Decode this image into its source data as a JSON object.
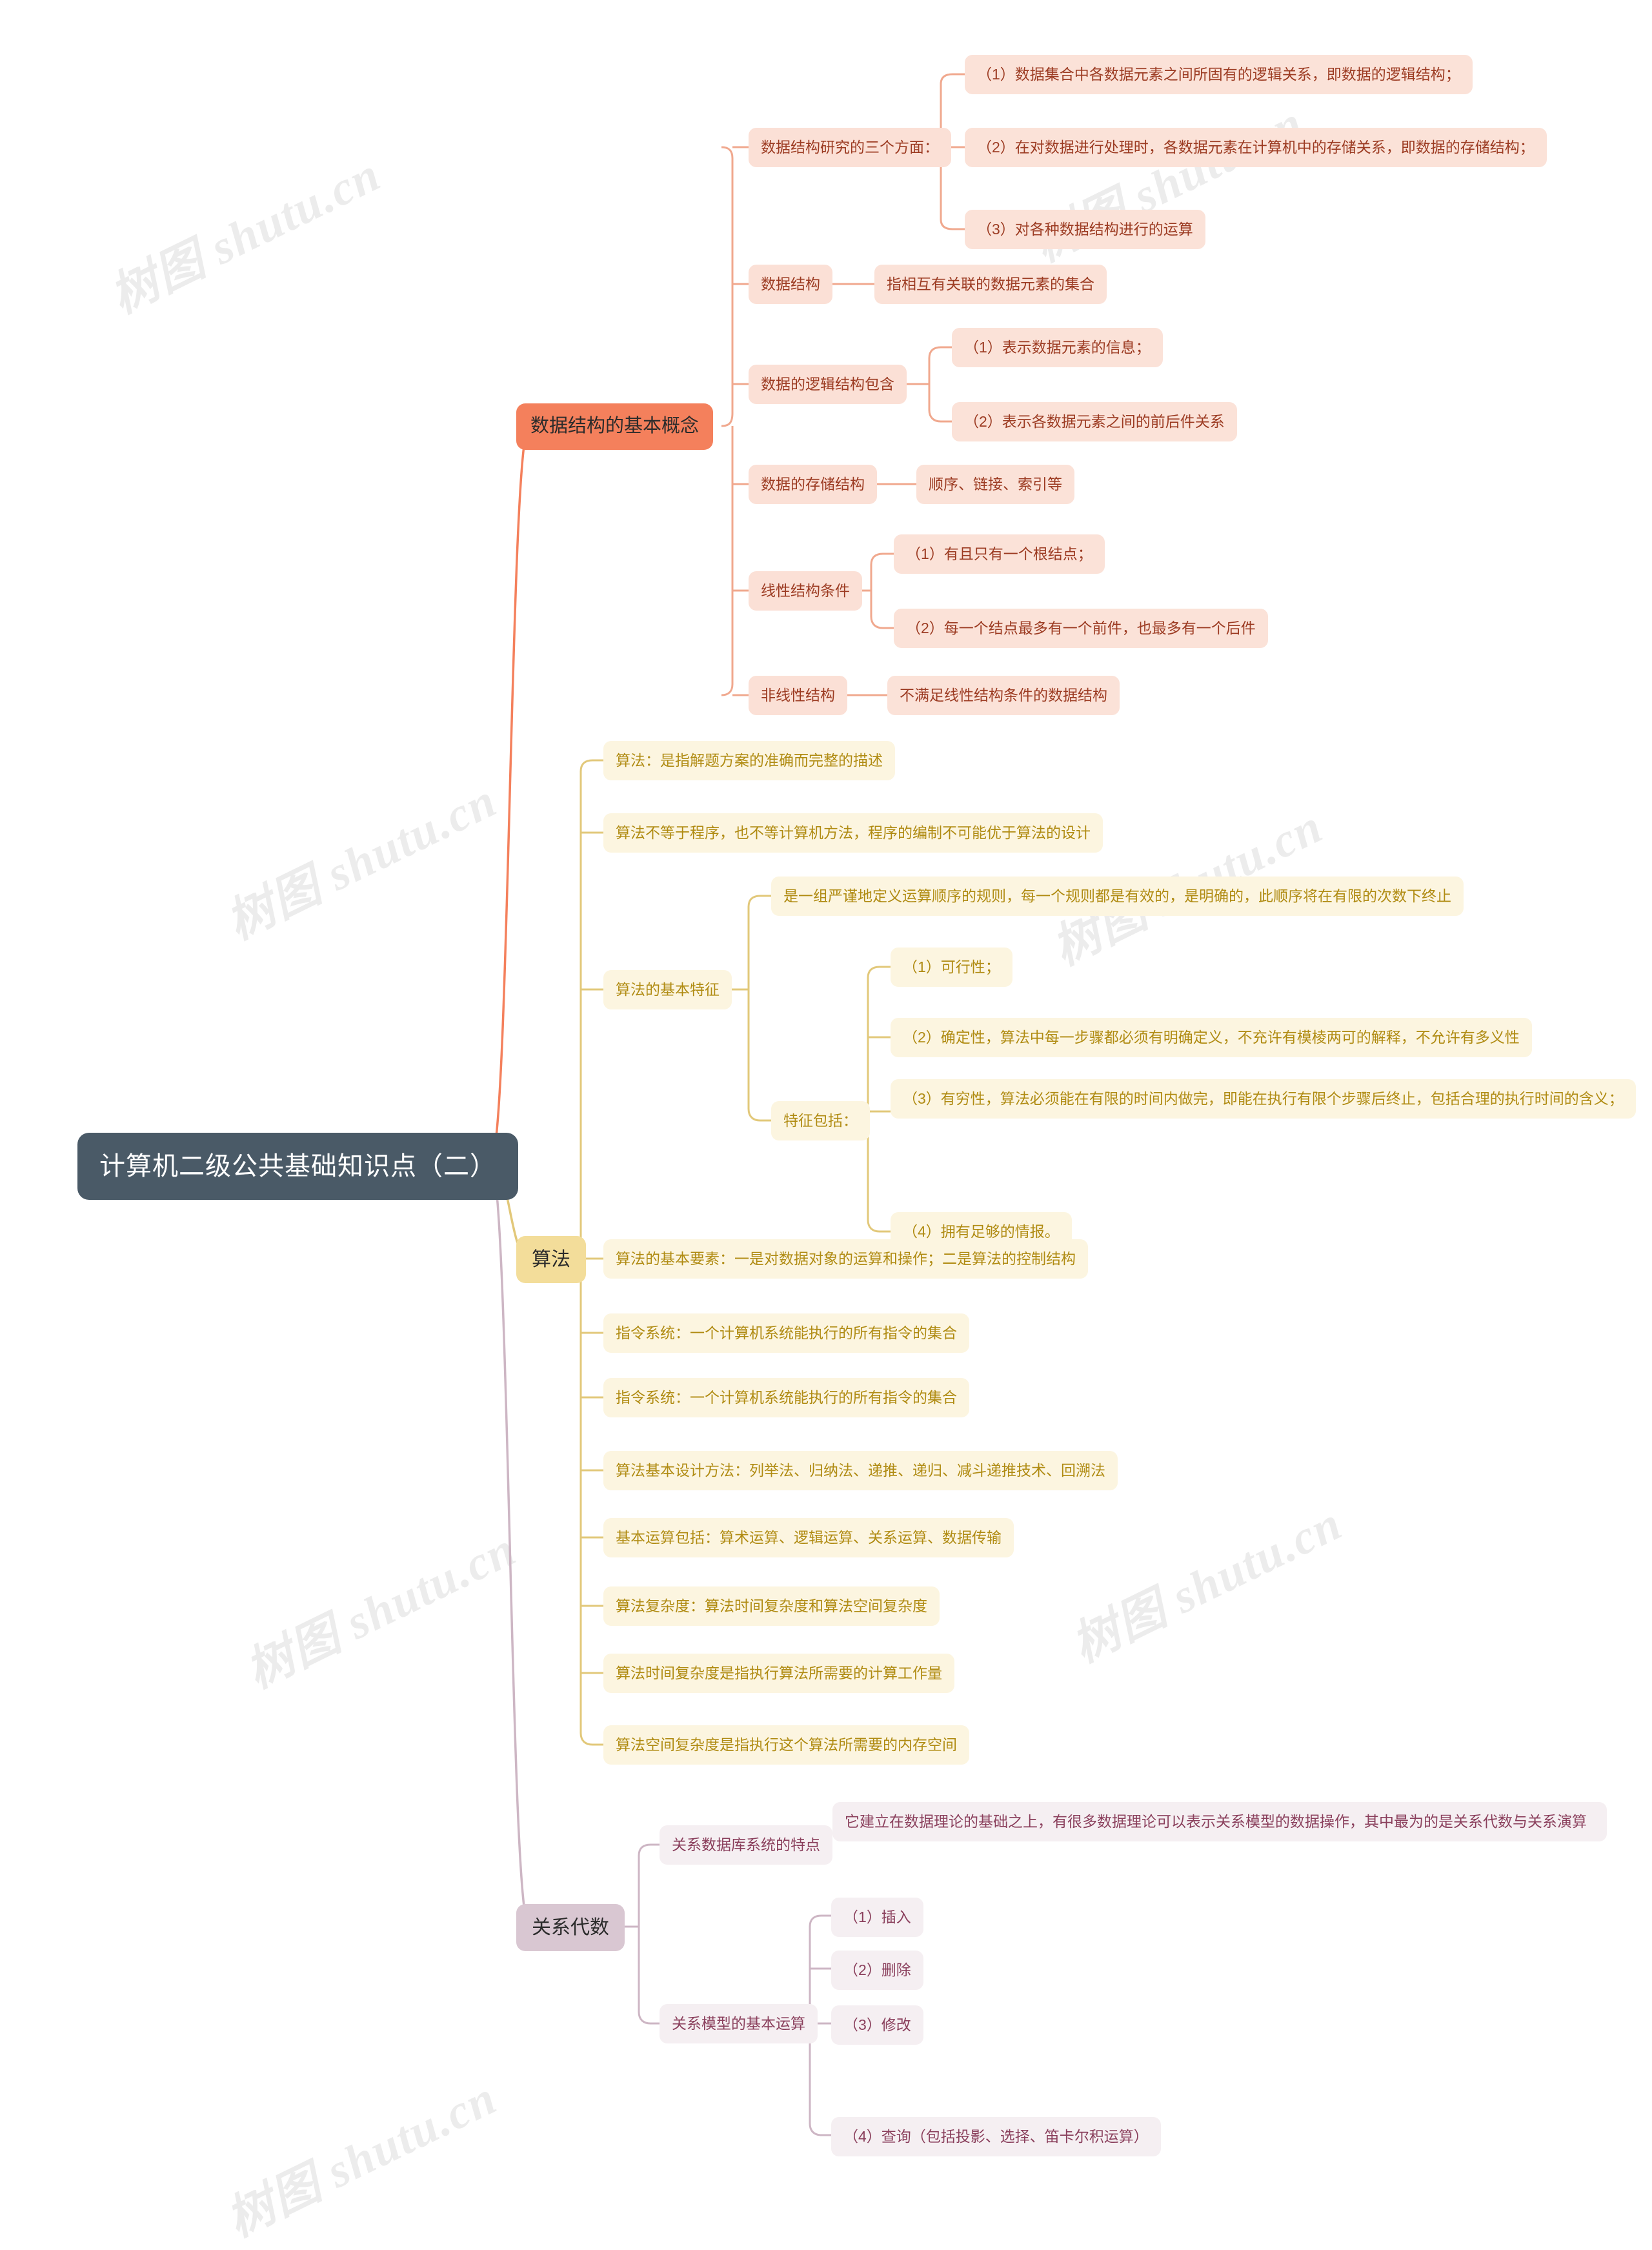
{
  "meta": {
    "theme_colors": {
      "page_background": "#ffffff",
      "root_fill": "#4a5a67",
      "root_text": "#ffffff",
      "branch1_accent": "#f4805c",
      "branch1_node_fill": "#fbe0d6",
      "branch1_text": "#9c3b22",
      "branch2_accent": "#f3dd9a",
      "branch2_node_fill": "#fcf5e0",
      "branch2_text": "#b08b12",
      "branch3_accent": "#d9c7d2",
      "branch3_node_fill": "#f5eff2",
      "branch3_text": "#8a3f5c"
    },
    "watermark_text": "树图 shutu.cn"
  },
  "root": {
    "label": "计算机二级公共基础知识点（二）"
  },
  "branches": [
    {
      "id": "data-structure",
      "label": "数据结构的基本概念",
      "children": [
        {
          "label": "数据结构研究的三个方面：",
          "children": [
            {
              "label": "（1）数据集合中各数据元素之间所固有的逻辑关系，即数据的逻辑结构；"
            },
            {
              "label": "（2）在对数据进行处理时，各数据元素在计算机中的存储关系，即数据的存储结构；"
            },
            {
              "label": "（3）对各种数据结构进行的运算"
            }
          ]
        },
        {
          "label": "数据结构",
          "children": [
            {
              "label": "指相互有关联的数据元素的集合"
            }
          ]
        },
        {
          "label": "数据的逻辑结构包含",
          "children": [
            {
              "label": "（1）表示数据元素的信息；"
            },
            {
              "label": "（2）表示各数据元素之间的前后件关系"
            }
          ]
        },
        {
          "label": "数据的存储结构",
          "children": [
            {
              "label": "顺序、链接、索引等"
            }
          ]
        },
        {
          "label": "线性结构条件",
          "children": [
            {
              "label": "（1）有且只有一个根结点；"
            },
            {
              "label": "（2）每一个结点最多有一个前件，也最多有一个后件"
            }
          ]
        },
        {
          "label": "非线性结构",
          "children": [
            {
              "label": "不满足线性结构条件的数据结构"
            }
          ]
        }
      ]
    },
    {
      "id": "algorithm",
      "label": "算法",
      "children": [
        {
          "label": "算法：是指解题方案的准确而完整的描述",
          "children": []
        },
        {
          "label": "算法不等于程序，也不等计算机方法，程序的编制不可能优于算法的设计",
          "children": []
        },
        {
          "label": "算法的基本特征",
          "children": [
            {
              "label": "是一组严谨地定义运算顺序的规则，每一个规则都是有效的，是明确的，此顺序将在有限的次数下终止"
            },
            {
              "label": "特征包括：",
              "children": [
                {
                  "label": "（1）可行性；"
                },
                {
                  "label": "（2）确定性，算法中每一步骤都必须有明确定义，不充许有模棱两可的解释，不允许有多义性"
                },
                {
                  "label": "（3）有穷性，算法必须能在有限的时间内做完，即能在执行有限个步骤后终止，包括合理的执行时间的含义；"
                },
                {
                  "label": "（4）拥有足够的情报。"
                }
              ]
            }
          ]
        },
        {
          "label": "算法的基本要素：一是对数据对象的运算和操作；二是算法的控制结构",
          "children": []
        },
        {
          "label": "指令系统：一个计算机系统能执行的所有指令的集合",
          "children": []
        },
        {
          "label": "指令系统：一个计算机系统能执行的所有指令的集合",
          "children": []
        },
        {
          "label": "算法基本设计方法：列举法、归纳法、递推、递归、减斗递推技术、回溯法",
          "children": []
        },
        {
          "label": "基本运算包括：算术运算、逻辑运算、关系运算、数据传输",
          "children": []
        },
        {
          "label": "算法复杂度：算法时间复杂度和算法空间复杂度",
          "children": []
        },
        {
          "label": "算法时间复杂度是指执行算法所需要的计算工作量",
          "children": []
        },
        {
          "label": "算法空间复杂度是指执行这个算法所需要的内存空间",
          "children": []
        }
      ]
    },
    {
      "id": "relational-algebra",
      "label": "关系代数",
      "children": [
        {
          "label": "关系数据库系统的特点",
          "children": [
            {
              "label": "它建立在数据理论的基础之上，有很多数据理论可以表示关系模型的数据操作，其中最为的是关系代数与关系演算"
            }
          ]
        },
        {
          "label": "关系模型的基本运算",
          "children": [
            {
              "label": "（1）插入"
            },
            {
              "label": "（2）删除"
            },
            {
              "label": "（3）修改"
            },
            {
              "label": "（4）查询（包括投影、选择、笛卡尔积运算）"
            }
          ]
        }
      ]
    }
  ]
}
